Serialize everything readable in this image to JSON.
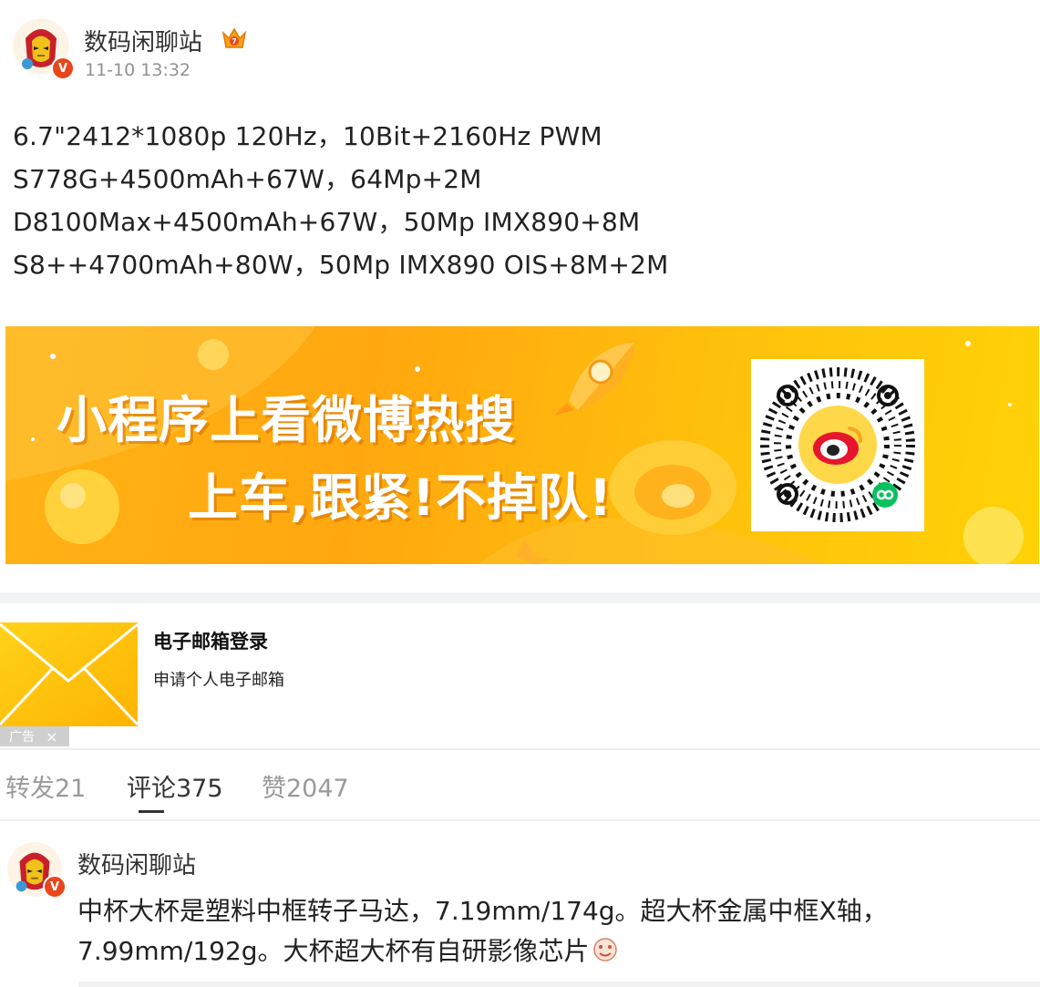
{
  "post": {
    "author": "数码闲聊站",
    "time": "11-10 13:32",
    "verified_badge": "V",
    "lines": [
      "6.7\"2412*1080p 120Hz，10Bit+2160Hz PWM",
      "S778G+4500mAh+67W，64Mp+2M",
      "D8100Max+4500mAh+67W，50Mp IMX890+8M",
      "S8++4700mAh+80W，50Mp IMX890 OIS+8M+2M"
    ]
  },
  "banner": {
    "line1": "小程序上看微博热搜",
    "line2": "上车,跟紧!不掉队!"
  },
  "ad": {
    "title": "电子邮箱登录",
    "subtitle": "申请个人电子邮箱",
    "tag": "广告",
    "close": "×"
  },
  "tabs": [
    {
      "label": "转发21"
    },
    {
      "label": "评论375"
    },
    {
      "label": "赞2047"
    }
  ],
  "comment": {
    "author": "数码闲聊站",
    "verified_badge": "V",
    "text": "中杯大杯是塑料中框转子马达，7.19mm/174g。超大杯金属中框X轴，7.99mm/192g。大杯超大杯有自研影像芯片"
  },
  "colors": {
    "banner_orange": "#ffa70f",
    "banner_yellow": "#ffd207",
    "weibo_red": "#e6162d",
    "verified_orange": "#e8461c",
    "muted_gray": "#939393"
  },
  "icons": [
    "crown-member-icon",
    "verified-icon",
    "weibo-logo-icon",
    "miniprogram-icon",
    "envelope-icon",
    "close-icon",
    "emoji-icon"
  ]
}
